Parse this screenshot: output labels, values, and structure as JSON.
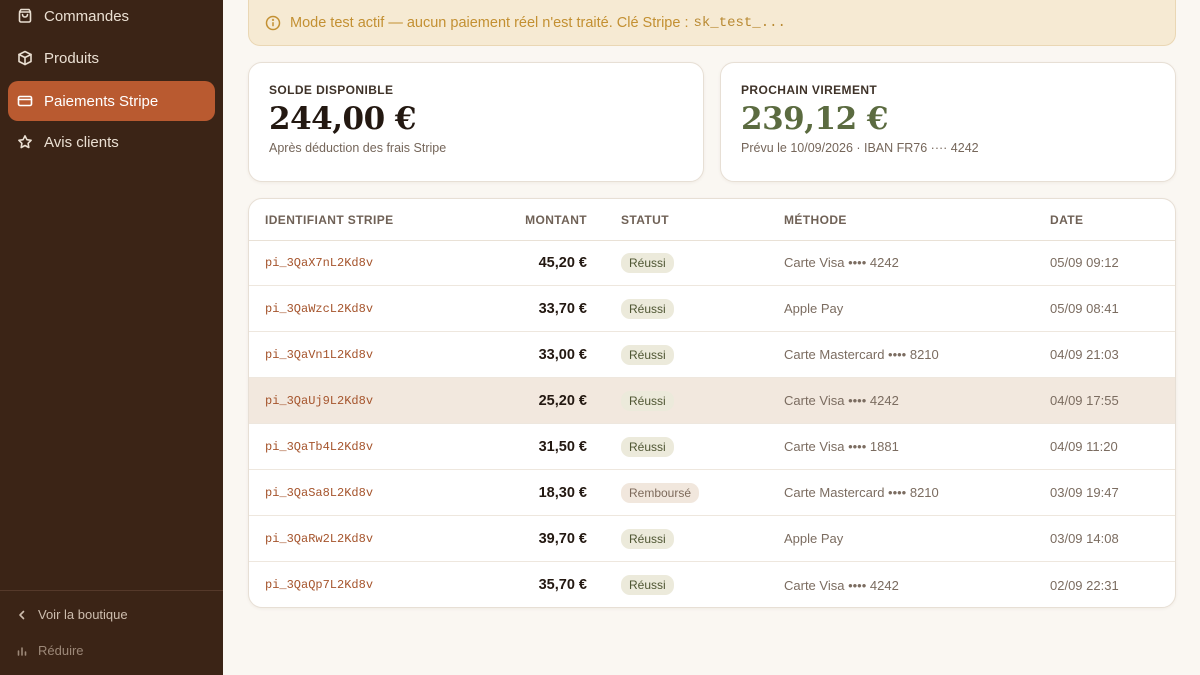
{
  "sidebar": {
    "items": [
      {
        "label": "Commandes",
        "icon": "shopping-bag-icon"
      },
      {
        "label": "Produits",
        "icon": "box-icon"
      },
      {
        "label": "Paiements Stripe",
        "icon": "credit-card-icon",
        "active": true
      },
      {
        "label": "Avis clients",
        "icon": "star-icon"
      }
    ],
    "footer": {
      "store_link": "Voir la boutique",
      "collapse": "Réduire"
    }
  },
  "banner": {
    "text": "Mode test actif — aucun paiement réel n'est traité. Clé Stripe :",
    "key": "sk_test_..."
  },
  "balance": {
    "label": "SOLDE DISPONIBLE",
    "value": "244,00 €",
    "note": "Après déduction des frais Stripe"
  },
  "payout": {
    "label": "PROCHAIN VIREMENT",
    "value": "239,12 €",
    "note": "Prévu le 10/09/2026 · IBAN FR76 ···· 4242"
  },
  "table": {
    "columns": [
      "IDENTIFIANT STRIPE",
      "MONTANT",
      "STATUT",
      "MÉTHODE",
      "DATE"
    ],
    "rows": [
      {
        "id": "pi_3QaX7nL2Kd8v",
        "amount": "45,20 €",
        "status": "Réussi",
        "method": "Carte Visa •••• 4242",
        "date": "05/09 09:12"
      },
      {
        "id": "pi_3QaWzcL2Kd8v",
        "amount": "33,70 €",
        "status": "Réussi",
        "method": "Apple Pay",
        "date": "05/09 08:41"
      },
      {
        "id": "pi_3QaVn1L2Kd8v",
        "amount": "33,00 €",
        "status": "Réussi",
        "method": "Carte Mastercard •••• 8210",
        "date": "04/09 21:03"
      },
      {
        "id": "pi_3QaUj9L2Kd8v",
        "amount": "25,20 €",
        "status": "Réussi",
        "method": "Carte Visa •••• 4242",
        "date": "04/09 17:55"
      },
      {
        "id": "pi_3QaTb4L2Kd8v",
        "amount": "31,50 €",
        "status": "Réussi",
        "method": "Carte Visa •••• 1881",
        "date": "04/09 11:20"
      },
      {
        "id": "pi_3QaSa8L2Kd8v",
        "amount": "18,30 €",
        "status": "Remboursé",
        "method": "Carte Mastercard •••• 8210",
        "date": "03/09 19:47"
      },
      {
        "id": "pi_3QaRw2L2Kd8v",
        "amount": "39,70 €",
        "status": "Réussi",
        "method": "Apple Pay",
        "date": "03/09 14:08"
      },
      {
        "id": "pi_3QaQp7L2Kd8v",
        "amount": "35,70 €",
        "status": "Réussi",
        "method": "Carte Visa •••• 4242",
        "date": "02/09 22:31"
      }
    ]
  },
  "colors": {
    "sidebar_bg": "#3b2416",
    "accent": "#b95a30",
    "payout_value": "#5b6b40",
    "banner_bg": "#f6ead3"
  }
}
